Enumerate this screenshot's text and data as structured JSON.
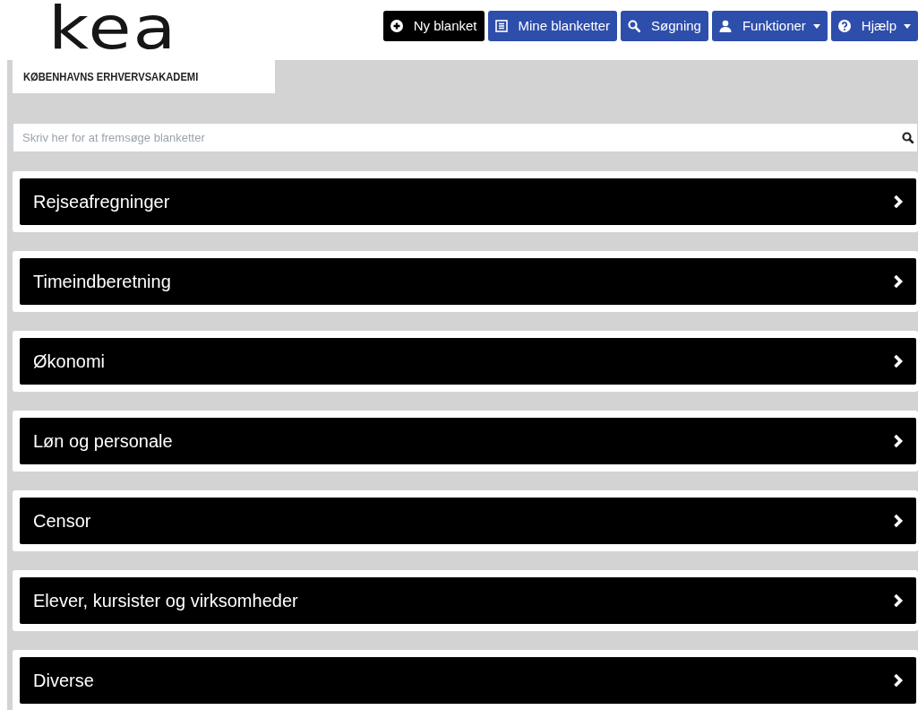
{
  "logo": {
    "wordmark": "kea",
    "subtitle": "KØBENHAVNS ERHVERVSAKADEMI"
  },
  "nav_buttons": [
    {
      "label": "Ny blanket",
      "kind": "plus",
      "selected": true,
      "dropdown": false
    },
    {
      "label": "Mine blanketter",
      "kind": "list",
      "selected": false,
      "dropdown": false
    },
    {
      "label": "Søgning",
      "kind": "search",
      "selected": false,
      "dropdown": false
    },
    {
      "label": "Funktioner",
      "kind": "user",
      "selected": false,
      "dropdown": true
    },
    {
      "label": "Hjælp",
      "kind": "help",
      "selected": false,
      "dropdown": true
    }
  ],
  "search": {
    "placeholder": "Skriv her for at fremsøge blanketter"
  },
  "categories": [
    {
      "label": "Rejseafregninger"
    },
    {
      "label": "Timeindberetning"
    },
    {
      "label": "Økonomi"
    },
    {
      "label": "Løn og personale"
    },
    {
      "label": "Censor"
    },
    {
      "label": "Elever, kursister og virksomheder"
    },
    {
      "label": "Diverse"
    }
  ]
}
